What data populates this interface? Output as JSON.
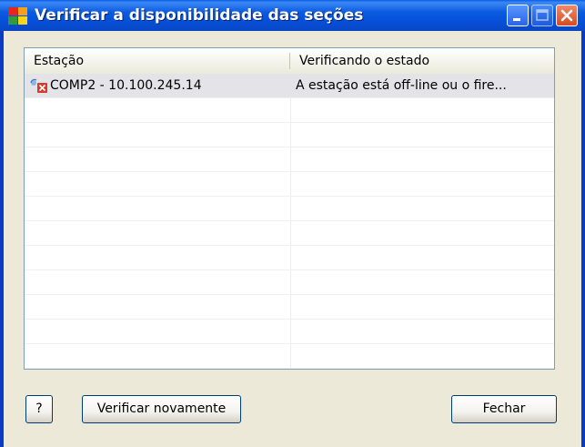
{
  "window": {
    "title": "Verificar a disponibilidade das seções"
  },
  "listview": {
    "columns": [
      "Estação",
      "Verificando o estado"
    ],
    "rows": [
      {
        "station": "COMP2 - 10.100.245.14",
        "status": "A estação está off-line ou o fire...",
        "icon": "offline-station-icon",
        "selected": true
      }
    ],
    "empty_rows": 11
  },
  "buttons": {
    "help_label": "?",
    "recheck_label": "Verificar novamente",
    "close_label": "Fechar"
  },
  "colors": {
    "titlebar": "#0a5ae0",
    "client_background": "#ece9d8",
    "selected_row": "#e3e3e8",
    "close_button": "#d84a20"
  }
}
